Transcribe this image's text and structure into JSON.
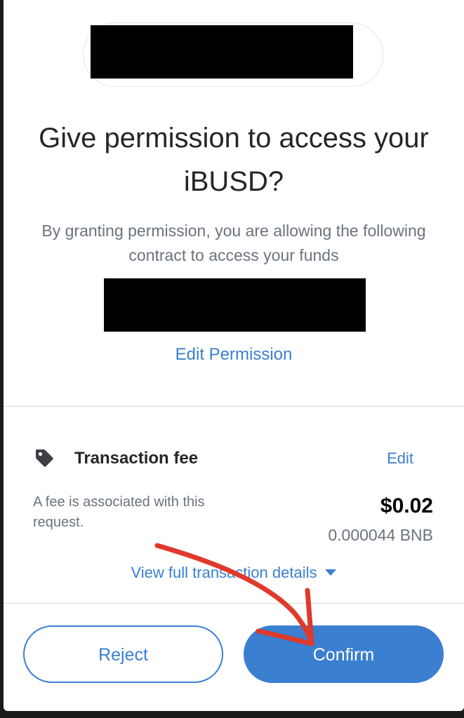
{
  "header": {
    "title": "Give permission to access your iBUSD?",
    "subtitle": "By granting permission, you are allowing the following contract to access your funds",
    "edit_permission_label": "Edit Permission"
  },
  "fee": {
    "icon": "tag-icon",
    "title": "Transaction fee",
    "edit_label": "Edit",
    "description": "A fee is associated with this request.",
    "amount_usd": "$0.02",
    "amount_native": "0.000044 BNB",
    "details_label": "View full transaction details"
  },
  "actions": {
    "reject_label": "Reject",
    "confirm_label": "Confirm"
  },
  "colors": {
    "accent": "#3a7fd0",
    "annotation": "#e0392b",
    "text_primary": "#24272a",
    "text_secondary": "#6a737d"
  }
}
